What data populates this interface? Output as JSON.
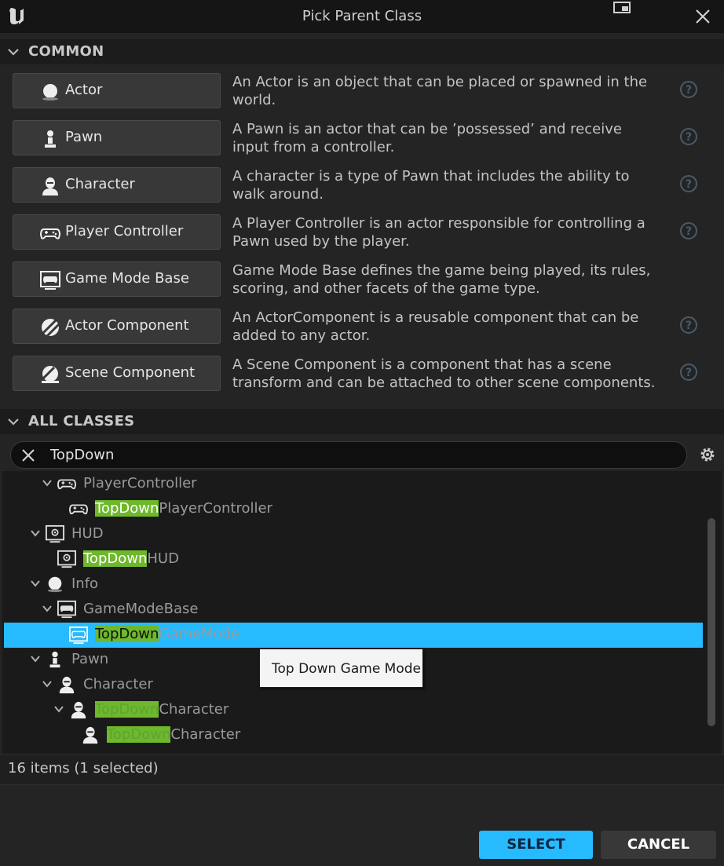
{
  "window": {
    "title": "Pick Parent Class"
  },
  "common": {
    "header": "COMMON",
    "items": [
      {
        "label": "Actor",
        "icon": "actor-sphere-icon",
        "description": "An Actor is an object that can be placed or spawned in the world.",
        "help": true
      },
      {
        "label": "Pawn",
        "icon": "pawn-icon",
        "description": "A Pawn is an actor that can be ’possessed’ and receive input from a controller.",
        "help": true
      },
      {
        "label": "Character",
        "icon": "character-icon",
        "description": "A character is a type of Pawn that includes the ability to walk around.",
        "help": true
      },
      {
        "label": "Player Controller",
        "icon": "gamepad-icon",
        "description": "A Player Controller is an actor responsible for controlling a Pawn used by the player.",
        "help": true
      },
      {
        "label": "Game Mode Base",
        "icon": "game-mode-icon",
        "description": "Game Mode Base defines the game being played, its rules, scoring, and other facets of the game type.",
        "help": false
      },
      {
        "label": "Actor Component",
        "icon": "actor-component-icon",
        "description": "An ActorComponent is a reusable component that can be added to any actor.",
        "help": true
      },
      {
        "label": "Scene Component",
        "icon": "scene-component-icon",
        "description": "A Scene Component is a component that has a scene transform and can be attached to other scene components.",
        "help": true
      }
    ]
  },
  "all_classes": {
    "header": "ALL CLASSES",
    "search": {
      "value": "TopDown",
      "placeholder": ""
    },
    "tree": [
      {
        "prefix": "",
        "rest": "PlayerController",
        "style": "dim",
        "icon": "gamepad-icon"
      },
      {
        "prefix": "TopDown",
        "rest": "PlayerController",
        "style": "white",
        "icon": "gamepad-icon"
      },
      {
        "prefix": "",
        "rest": "HUD",
        "style": "dim",
        "icon": "hud-icon"
      },
      {
        "prefix": "TopDown",
        "rest": "HUD",
        "style": "white",
        "icon": "hud-icon"
      },
      {
        "prefix": "",
        "rest": "Info",
        "style": "dim",
        "icon": "info-sphere-icon"
      },
      {
        "prefix": "",
        "rest": "GameModeBase",
        "style": "dim",
        "icon": "game-mode-icon"
      },
      {
        "prefix": "TopDown",
        "rest": "GameMode",
        "style": "selected",
        "icon": "game-mode-icon"
      },
      {
        "prefix": "",
        "rest": "Pawn",
        "style": "dimblue",
        "icon": "pawn-icon"
      },
      {
        "prefix": "",
        "rest": "Character",
        "style": "dimblue",
        "icon": "character-icon"
      },
      {
        "prefix": "TopDown",
        "rest": "Character",
        "style": "blue",
        "icon": "character-icon"
      },
      {
        "prefix": "TopDown",
        "rest": "Character",
        "style": "blue",
        "icon": "character-icon"
      }
    ],
    "tooltip": "Top Down Game Mode",
    "status": "16 items (1 selected)"
  },
  "footer": {
    "select_label": "SELECT",
    "cancel_label": "CANCEL"
  },
  "colors": {
    "accent": "#26bbff",
    "highlight": "#6eb82c",
    "background": "#242424"
  }
}
